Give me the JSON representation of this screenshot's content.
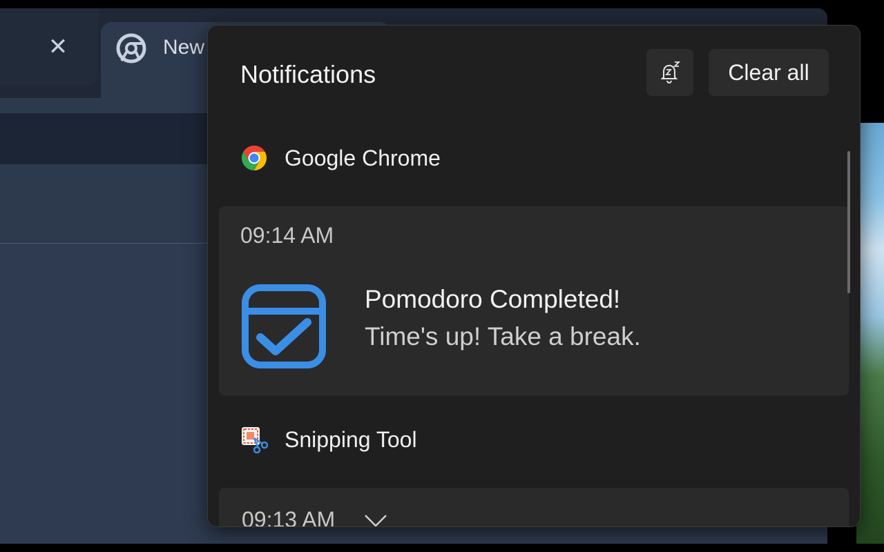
{
  "browser": {
    "tab_close_glyph": "✕",
    "active_tab_title": "New",
    "tab_icon": "chrome-tab-icon"
  },
  "notification_center": {
    "title": "Notifications",
    "dnd_icon": "bell-snooze-icon",
    "clear_all_label": "Clear all",
    "groups": [
      {
        "app_name": "Google Chrome",
        "app_icon": "google-chrome-icon",
        "notifications": [
          {
            "time": "09:14 AM",
            "icon": "calendar-check-icon",
            "title": "Pomodoro Completed!",
            "body": "Time's up! Take a break."
          }
        ]
      },
      {
        "app_name": "Snipping Tool",
        "app_icon": "snipping-tool-icon",
        "notifications": [
          {
            "time": "09:13 AM",
            "expand_icon": "chevron-down-icon"
          }
        ]
      }
    ]
  },
  "colors": {
    "accent_blue": "#3b8ee6",
    "panel_bg": "#1f1f1f",
    "card_bg": "#2a2a2a"
  }
}
